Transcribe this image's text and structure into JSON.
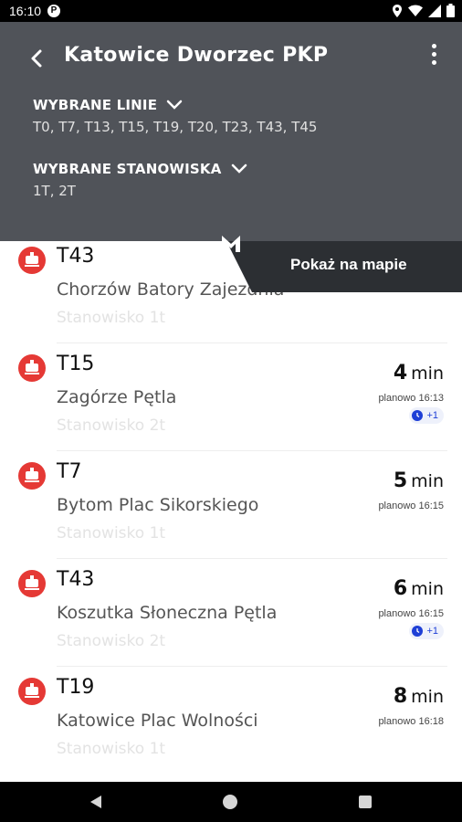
{
  "status_bar": {
    "time": "16:10",
    "app_icon_letter": "P",
    "icons": [
      "location-icon",
      "wifi-icon",
      "signal-icon",
      "battery-icon"
    ]
  },
  "header": {
    "title": "Katowice Dworzec PKP",
    "lines_label": "WYBRANE LINIE",
    "lines_value": "T0, T7, T13, T15, T19, T20, T23, T43, T45",
    "stands_label": "WYBRANE STANOWISKA",
    "stands_value": "1T, 2T",
    "background_color": "#505359"
  },
  "map_button": {
    "label": "Pokaż na mapie",
    "logo_letter": "M"
  },
  "departures": [
    {
      "line": "T43",
      "destination": "Chorzów Batory Zajezdnia",
      "stand": "Stanowisko 1t",
      "minutes": "",
      "unit": "",
      "planned": "",
      "delay": ""
    },
    {
      "line": "T15",
      "destination": "Zagórze Pętla",
      "stand": "Stanowisko 2t",
      "minutes": "4",
      "unit": "min",
      "planned": "planowo 16:13",
      "delay": "+1"
    },
    {
      "line": "T7",
      "destination": "Bytom Plac Sikorskiego",
      "stand": "Stanowisko 1t",
      "minutes": "5",
      "unit": "min",
      "planned": "planowo 16:15",
      "delay": ""
    },
    {
      "line": "T43",
      "destination": "Koszutka Słoneczna Pętla",
      "stand": "Stanowisko 2t",
      "minutes": "6",
      "unit": "min",
      "planned": "planowo 16:15",
      "delay": "+1"
    },
    {
      "line": "T19",
      "destination": "Katowice Plac Wolności",
      "stand": "Stanowisko 1t",
      "minutes": "8",
      "unit": "min",
      "planned": "planowo 16:18",
      "delay": ""
    }
  ],
  "colors": {
    "accent_red": "#e53935",
    "delay_blue": "#1e3fd6",
    "dark_button": "#2c2f33"
  }
}
